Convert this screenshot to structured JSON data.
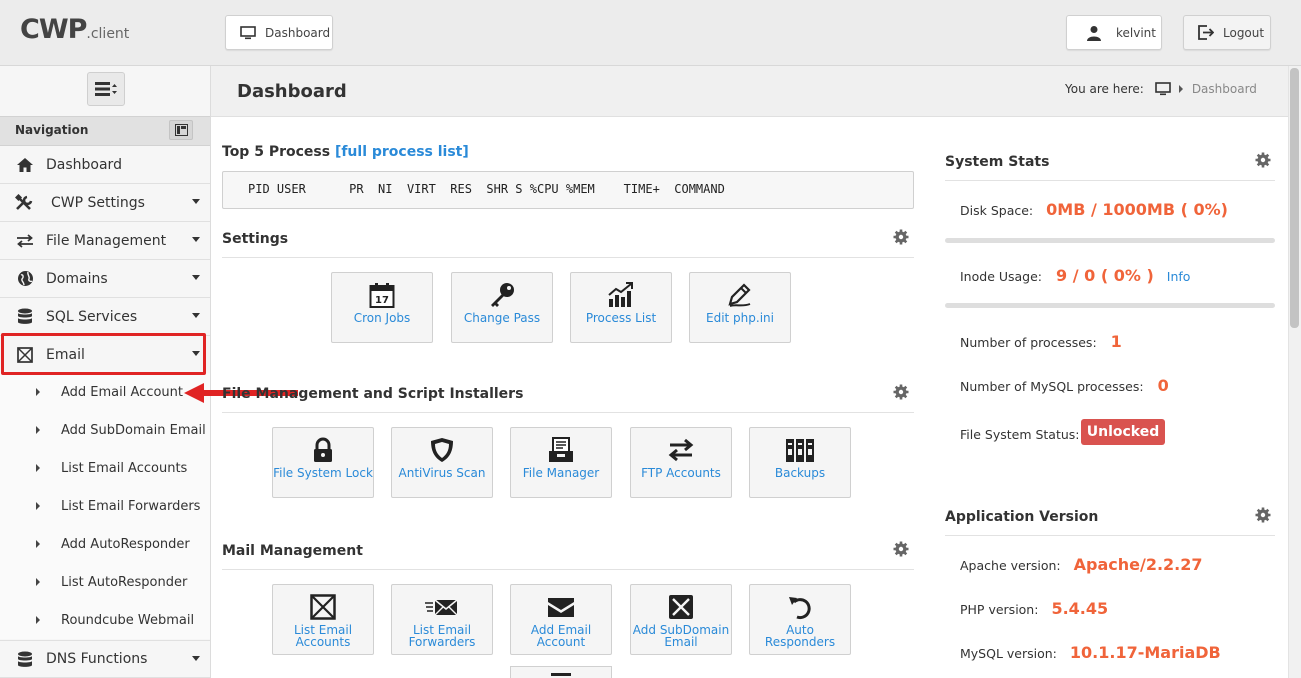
{
  "app": {
    "brand": "CWP",
    "brand_suffix": ".client"
  },
  "topbar": {
    "dashboard_tab": "Dashboard",
    "user": "kelvint",
    "logout": "Logout"
  },
  "sidebar": {
    "title": "Navigation",
    "items": [
      {
        "label": "Dashboard",
        "icon": "home-icon"
      },
      {
        "label": "CWP Settings",
        "icon": "tools-icon"
      },
      {
        "label": "File Management",
        "icon": "exchange-icon"
      },
      {
        "label": "Domains",
        "icon": "globe-icon"
      },
      {
        "label": "SQL Services",
        "icon": "database-icon"
      },
      {
        "label": "Email",
        "icon": "mail-icon"
      }
    ],
    "email_sub": [
      "Add Email Account",
      "Add SubDomain Email",
      "List Email Accounts",
      "List Email Forwarders",
      "Add AutoResponder",
      "List AutoResponder",
      "Roundcube Webmail"
    ],
    "bottom_item": {
      "label": "DNS Functions",
      "icon": "database-icon"
    }
  },
  "header": {
    "title": "Dashboard",
    "breadcrumb_prefix": "You are here:",
    "breadcrumb_current": "Dashboard"
  },
  "process": {
    "title": "Top 5 Process",
    "link": "[full process list]",
    "columns": "PID USER      PR  NI  VIRT  RES  SHR S %CPU %MEM    TIME+  COMMAND"
  },
  "settings": {
    "title": "Settings",
    "buttons": [
      {
        "label": "Cron Jobs",
        "icon": "calendar-icon",
        "day": "17"
      },
      {
        "label": "Change Pass",
        "icon": "key-icon"
      },
      {
        "label": "Process List",
        "icon": "chart-icon"
      },
      {
        "label": "Edit php.ini",
        "icon": "pencil-icon"
      }
    ]
  },
  "filemgmt": {
    "title": "File Management and Script Installers",
    "buttons": [
      {
        "label": "File System Lock",
        "icon": "lock-icon"
      },
      {
        "label": "AntiVirus Scan",
        "icon": "shield-icon"
      },
      {
        "label": "File Manager",
        "icon": "file-manager-icon"
      },
      {
        "label": "FTP Accounts",
        "icon": "exchange-icon"
      },
      {
        "label": "Backups",
        "icon": "archive-icon"
      }
    ]
  },
  "mail": {
    "title": "Mail Management",
    "buttons": [
      {
        "line1": "List Email",
        "line2": "Accounts",
        "icon": "mail-box-icon"
      },
      {
        "line1": "List Email",
        "line2": "Forwarders",
        "icon": "mail-forward-icon"
      },
      {
        "line1": "Add Email",
        "line2": "Account",
        "icon": "envelope-icon"
      },
      {
        "line1": "Add SubDomain",
        "line2": "Email",
        "icon": "mail-box-icon"
      },
      {
        "line1": "Auto",
        "line2": "Responders",
        "icon": "undo-icon"
      }
    ]
  },
  "system_stats": {
    "title": "System Stats",
    "disk_label": "Disk Space:",
    "disk_value": "0MB / 1000MB ( 0%)",
    "disk_percent": 0,
    "inode_label": "Inode Usage:",
    "inode_value": "9 / 0 ( 0% )",
    "inode_info": "Info",
    "inode_percent": 0,
    "proc_label": "Number of processes:",
    "proc_value": "1",
    "mysql_proc_label": "Number of MySQL processes:",
    "mysql_proc_value": "0",
    "fs_label": "File System Status:",
    "fs_value": "Unlocked"
  },
  "app_version": {
    "title": "Application Version",
    "apache_label": "Apache version:",
    "apache_value": "Apache/2.2.27",
    "php_label": "PHP version:",
    "php_value": "5.4.45",
    "mysql_label": "MySQL version:",
    "mysql_value": "10.1.17-MariaDB"
  },
  "colors": {
    "accent": "#f0643a",
    "link": "#2a8ad8",
    "danger": "#d9534f",
    "highlight": "#e02424"
  }
}
